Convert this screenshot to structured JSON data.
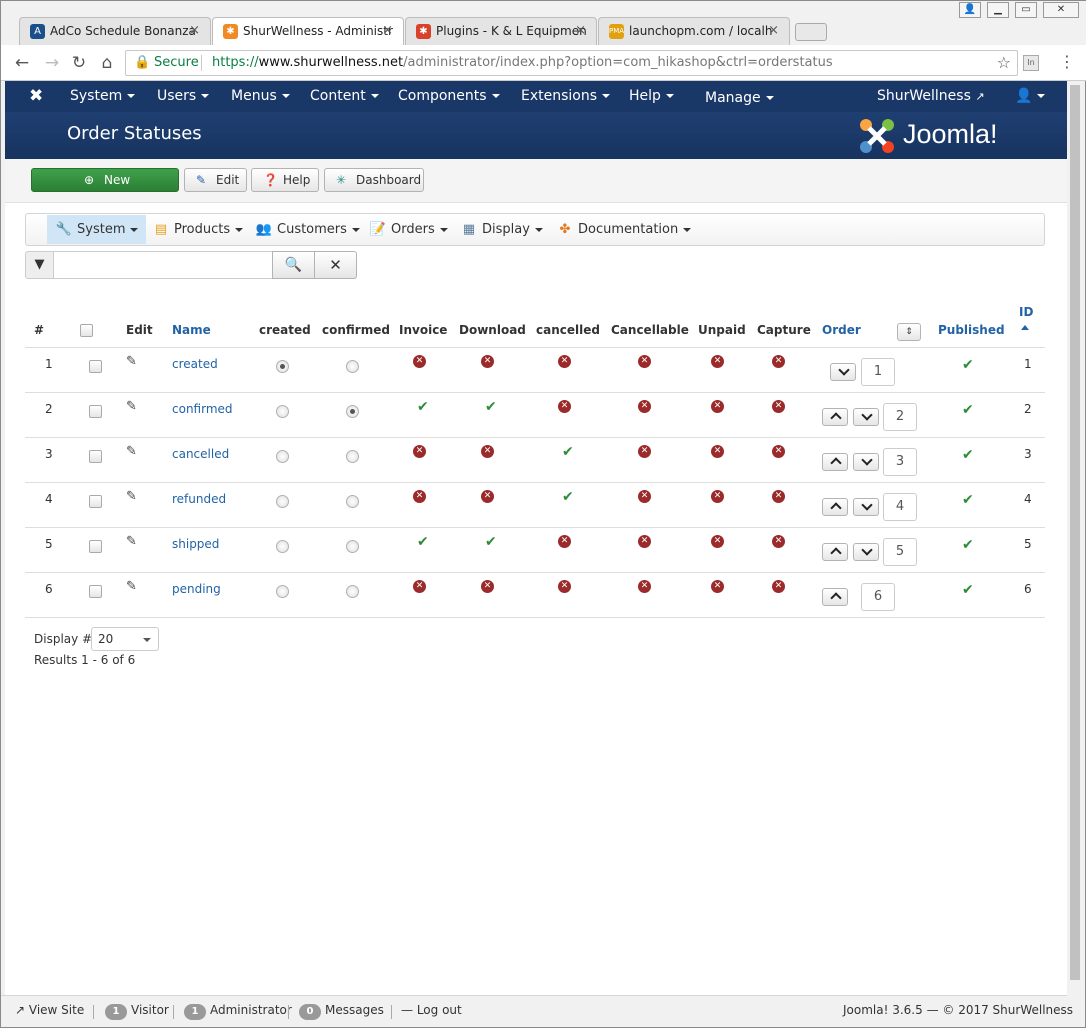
{
  "browser": {
    "tabs": [
      {
        "label": "AdCo Schedule Bonanza",
        "close": "×",
        "active": false
      },
      {
        "label": "ShurWellness - Administr",
        "close": "×",
        "active": true
      },
      {
        "label": "Plugins - K & L Equipmen",
        "close": "×",
        "active": false
      },
      {
        "label": "launchopm.com / localh",
        "close": "×",
        "active": false
      }
    ],
    "secure_label": "Secure",
    "url": {
      "scheme": "https://",
      "host": "www.shurwellness.net",
      "path": "/administrator/index.php?option=com_hikashop&ctrl=orderstatus"
    }
  },
  "topnav": {
    "menus": [
      "System",
      "Users",
      "Menus",
      "Content",
      "Components",
      "Extensions",
      "Help",
      "Manage"
    ],
    "site_name": "ShurWellness"
  },
  "header": {
    "page_title": "Order Statuses",
    "brand": "Joomla!"
  },
  "toolbar": {
    "new_label": "New",
    "edit_label": "Edit",
    "help_label": "Help",
    "dashboard_label": "Dashboard"
  },
  "hikashop_nav": {
    "items": [
      "System",
      "Products",
      "Customers",
      "Orders",
      "Display",
      "Documentation"
    ]
  },
  "search": {
    "value": "",
    "placeholder": ""
  },
  "table": {
    "headers": {
      "num": "#",
      "edit": "Edit",
      "name": "Name",
      "created": "created",
      "confirmed": "confirmed",
      "invoice": "Invoice",
      "download": "Download",
      "cancelled": "cancelled",
      "cancellable": "Cancellable",
      "unpaid": "Unpaid",
      "capture": "Capture",
      "order": "Order",
      "published": "Published",
      "id": "ID"
    },
    "rows": [
      {
        "num": "1",
        "name": "created",
        "created": true,
        "confirmed": false,
        "invoice": false,
        "download": false,
        "cancelled": false,
        "cancellable": false,
        "unpaid": false,
        "capture": false,
        "order": "1",
        "published": true,
        "id": "1"
      },
      {
        "num": "2",
        "name": "confirmed",
        "created": false,
        "confirmed": true,
        "invoice": true,
        "download": true,
        "cancelled": false,
        "cancellable": false,
        "unpaid": false,
        "capture": false,
        "order": "2",
        "published": true,
        "id": "2"
      },
      {
        "num": "3",
        "name": "cancelled",
        "created": false,
        "confirmed": false,
        "invoice": false,
        "download": false,
        "cancelled": true,
        "cancellable": false,
        "unpaid": false,
        "capture": false,
        "order": "3",
        "published": true,
        "id": "3"
      },
      {
        "num": "4",
        "name": "refunded",
        "created": false,
        "confirmed": false,
        "invoice": false,
        "download": false,
        "cancelled": true,
        "cancellable": false,
        "unpaid": false,
        "capture": false,
        "order": "4",
        "published": true,
        "id": "4"
      },
      {
        "num": "5",
        "name": "shipped",
        "created": false,
        "confirmed": false,
        "invoice": true,
        "download": true,
        "cancelled": false,
        "cancellable": false,
        "unpaid": false,
        "capture": false,
        "order": "5",
        "published": true,
        "id": "5"
      },
      {
        "num": "6",
        "name": "pending",
        "created": false,
        "confirmed": false,
        "invoice": false,
        "download": false,
        "cancelled": false,
        "cancellable": false,
        "unpaid": false,
        "capture": false,
        "order": "6",
        "published": true,
        "id": "6"
      }
    ]
  },
  "pagination": {
    "display_label": "Display #",
    "display_value": "20",
    "results_text": "Results 1 - 6 of 6"
  },
  "statusbar": {
    "view_site": "View Site",
    "visitor_count": "1",
    "visitor_label": "Visitor",
    "admin_count": "1",
    "admin_label": "Administrator",
    "messages_count": "0",
    "messages_label": "Messages",
    "logout_label": "Log out",
    "version_text": "Joomla! 3.6.5 — © 2017 ShurWellness"
  },
  "colors": {
    "nav_bg": "#1a3867",
    "header_bg": "#1f3f72",
    "new_button": "#3a9a45",
    "link": "#2263a6",
    "check": "#2e8b3a",
    "cross": "#9b2a2a"
  },
  "icons": {
    "filter": "funnel-icon",
    "search": "search-icon",
    "clear": "close-icon",
    "edit_row": "pencil-icon",
    "true_value": "check-icon",
    "false_value": "x-circle-icon"
  }
}
